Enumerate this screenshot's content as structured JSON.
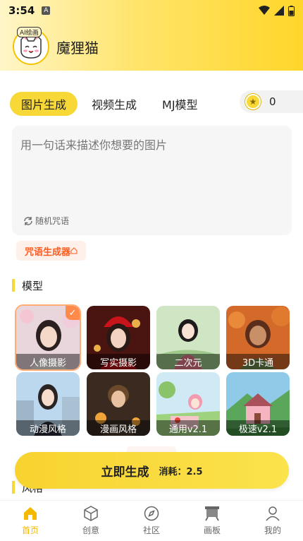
{
  "status_bar": {
    "time": "3:54",
    "notif_letter": "A"
  },
  "app": {
    "name": "魔狸猫",
    "logo_badge": "AI绘画"
  },
  "tabs": [
    {
      "label": "图片生成",
      "active": true
    },
    {
      "label": "视频生成",
      "active": false
    },
    {
      "label": "MJ模型",
      "active": false
    }
  ],
  "coins": {
    "count": "0"
  },
  "prompt": {
    "placeholder": "用一句话来描述你想要的图片",
    "random_label": "随机咒语"
  },
  "spell_generator": {
    "label": "咒语生成器"
  },
  "models_section": {
    "title": "模型"
  },
  "models": [
    {
      "label": "人像摄影",
      "selected": true
    },
    {
      "label": "写实摄影",
      "selected": false
    },
    {
      "label": "二次元",
      "selected": false
    },
    {
      "label": "3D卡通",
      "selected": false
    },
    {
      "label": "动漫风格",
      "selected": false
    },
    {
      "label": "漫画风格",
      "selected": false
    },
    {
      "label": "通用v2.1",
      "selected": false
    },
    {
      "label": "极速v2.1",
      "selected": false
    }
  ],
  "style_section": {
    "title": "风格"
  },
  "generate": {
    "label": "立即生成",
    "cost": "消耗：2.5"
  },
  "nav": [
    {
      "label": "首页",
      "icon": "home-icon",
      "active": true
    },
    {
      "label": "创意",
      "icon": "cube-icon",
      "active": false
    },
    {
      "label": "社区",
      "icon": "compass-icon",
      "active": false
    },
    {
      "label": "画板",
      "icon": "easel-icon",
      "active": false
    },
    {
      "label": "我的",
      "icon": "user-icon",
      "active": false
    }
  ],
  "colors": {
    "accent": "#f8d836",
    "orange": "#ff5a1f",
    "nav_active": "#f5b800"
  }
}
